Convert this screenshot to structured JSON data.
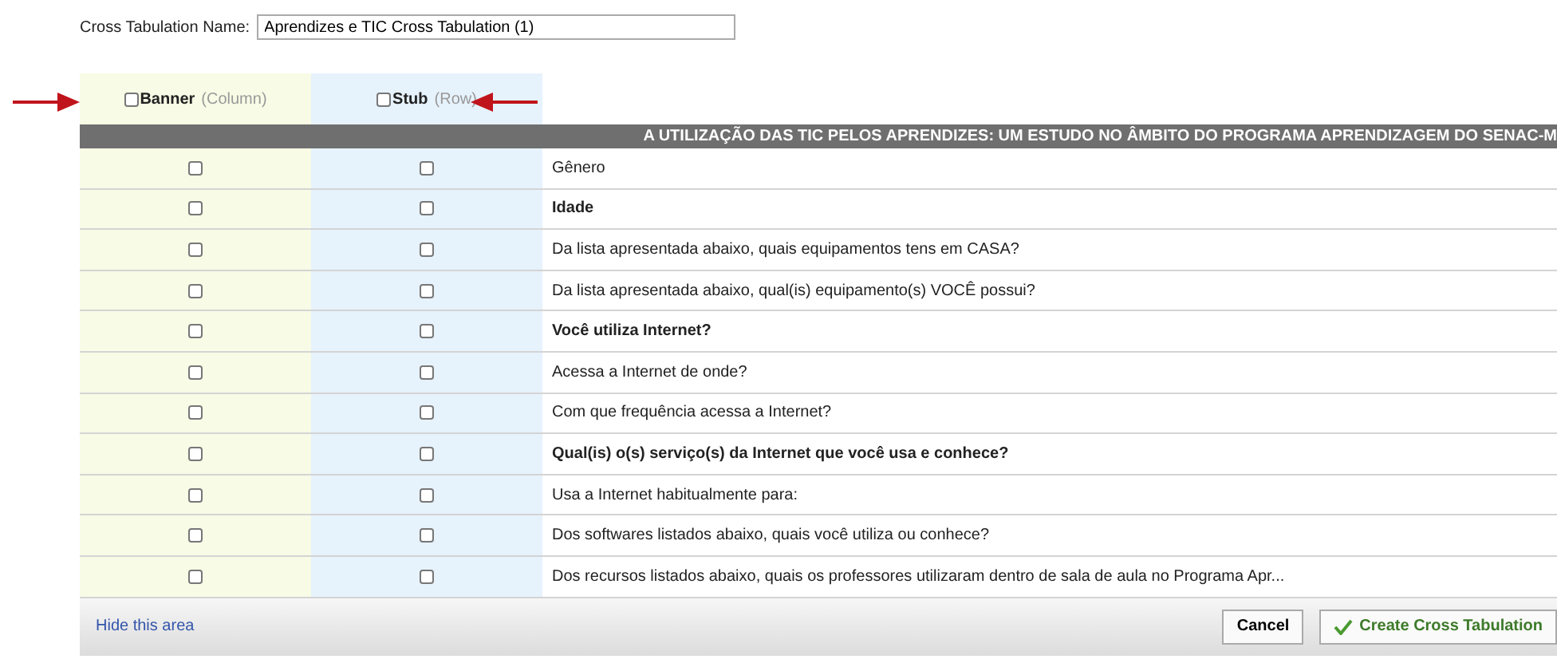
{
  "name_field": {
    "label": "Cross Tabulation Name:",
    "value": "Aprendizes e TIC Cross Tabulation (1)"
  },
  "columns": [
    {
      "label": "Banner",
      "hint": "(Column)",
      "checked": false
    },
    {
      "label": "Stub",
      "hint": "(Row)",
      "checked": false
    }
  ],
  "survey_title": "A UTILIZAÇÃO DAS TIC PELOS APRENDIZES: UM ESTUDO NO ÂMBITO DO PROGRAMA APRENDIZAGEM DO SENAC-M",
  "questions": [
    {
      "text": "Gênero",
      "bold": false,
      "banner": false,
      "stub": false
    },
    {
      "text": "Idade",
      "bold": true,
      "banner": false,
      "stub": false
    },
    {
      "text": "Da lista apresentada abaixo, quais equipamentos tens em CASA?",
      "bold": false,
      "banner": false,
      "stub": false
    },
    {
      "text": "Da lista apresentada abaixo, qual(is) equipamento(s) VOCÊ possui?",
      "bold": false,
      "banner": false,
      "stub": false
    },
    {
      "text": "Você utiliza Internet?",
      "bold": true,
      "banner": false,
      "stub": false
    },
    {
      "text": "Acessa a Internet de onde?",
      "bold": false,
      "banner": false,
      "stub": false
    },
    {
      "text": "Com que frequência acessa a Internet?",
      "bold": false,
      "banner": false,
      "stub": false
    },
    {
      "text": "Qual(is) o(s) serviço(s) da Internet que você usa e conhece?",
      "bold": true,
      "banner": false,
      "stub": false
    },
    {
      "text": "Usa a Internet habitualmente para:",
      "bold": false,
      "banner": false,
      "stub": false
    },
    {
      "text": "Dos softwares listados abaixo, quais você utiliza ou conhece?",
      "bold": false,
      "banner": false,
      "stub": false
    },
    {
      "text": "Dos recursos listados abaixo, quais os professores utilizaram dentro de sala de aula no Programa Apr...",
      "bold": false,
      "banner": false,
      "stub": false
    }
  ],
  "footer": {
    "link": "Hide this area",
    "buttons": [
      {
        "label": "Cancel",
        "kind": "plain"
      },
      {
        "label": "Create Cross Tabulation",
        "kind": "confirm"
      }
    ]
  }
}
